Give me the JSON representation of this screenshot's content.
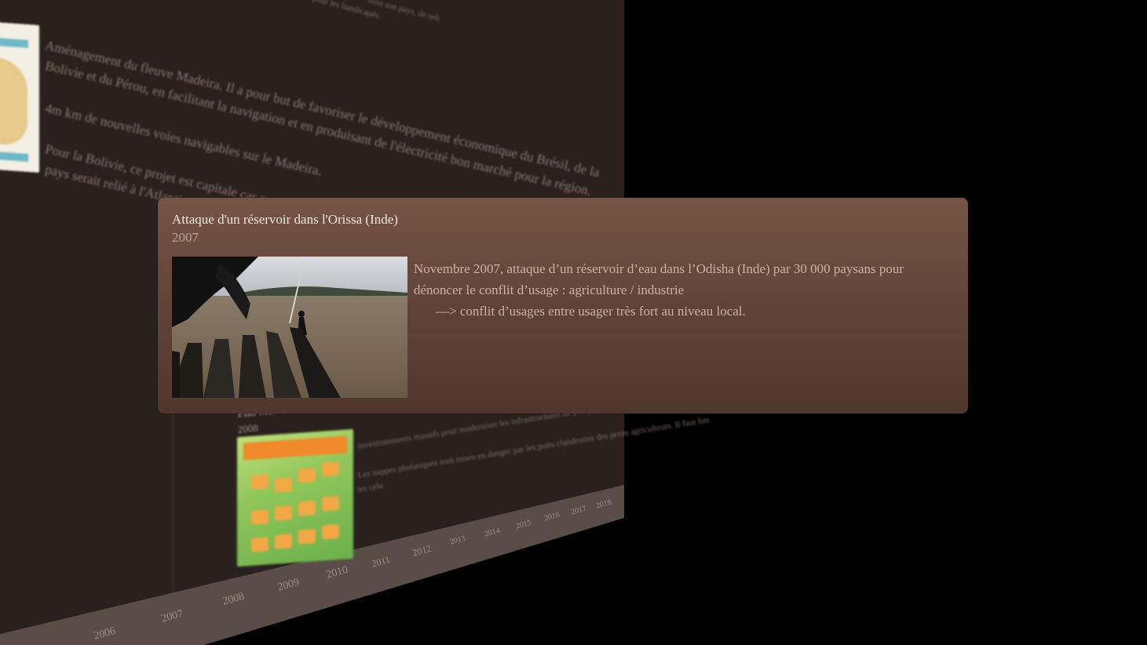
{
  "timeline_background": {
    "paragraphs": [
      "ssiss son pays, de reli",
      "pour les handicapés.",
      "Aménagement du fleuve Madeira. Il a pour but de favoriser le développement économique du Brésil, de la",
      "Bolivie et du Pérou, en facilitant la navigation et en produisant de l'électricité bon marché pour la région.",
      "4m km de nouvelles voies navigables sur le Madeira.",
      "Pour la Bolivie, ce projet est capitale car ce pays est enclavé et n'a pas de connexio",
      "pays serait relié à l'Atlantique"
    ],
    "event": {
      "title": "Plan Maroc Vert",
      "date": "2008",
      "lines": [
        "investissements massifs pour moderniser les infrastructures de pompage.",
        "Les nappes phréatiques sont mises en danger par les puits clandestins des petits agriculteurs. Il faut lim",
        "ter cela"
      ]
    },
    "ticks": [
      "2006",
      "2007",
      "2008",
      "2009",
      "2010",
      "2011",
      "2012",
      "2013",
      "2014",
      "2015",
      "2016",
      "2017",
      "2018"
    ]
  },
  "popup": {
    "title": "Attaque d'un réservoir dans l'Orissa (Inde)",
    "date": "2007",
    "photo_alt": "",
    "body_line1": "Novembre 2007, attaque d’un réservoir d’eau dans l’Odisha (Inde) par 30 000 paysans pour",
    "body_line2": "dénoncer le conflit d’usage : agriculture / industrie",
    "body_line3": "—> conflit d’usages entre usager très fort au niveau local."
  },
  "colors": {
    "background": "#000000",
    "timeline_plane": "#2a201d",
    "popup_top": "#775445",
    "popup_bottom": "#4f372e"
  }
}
